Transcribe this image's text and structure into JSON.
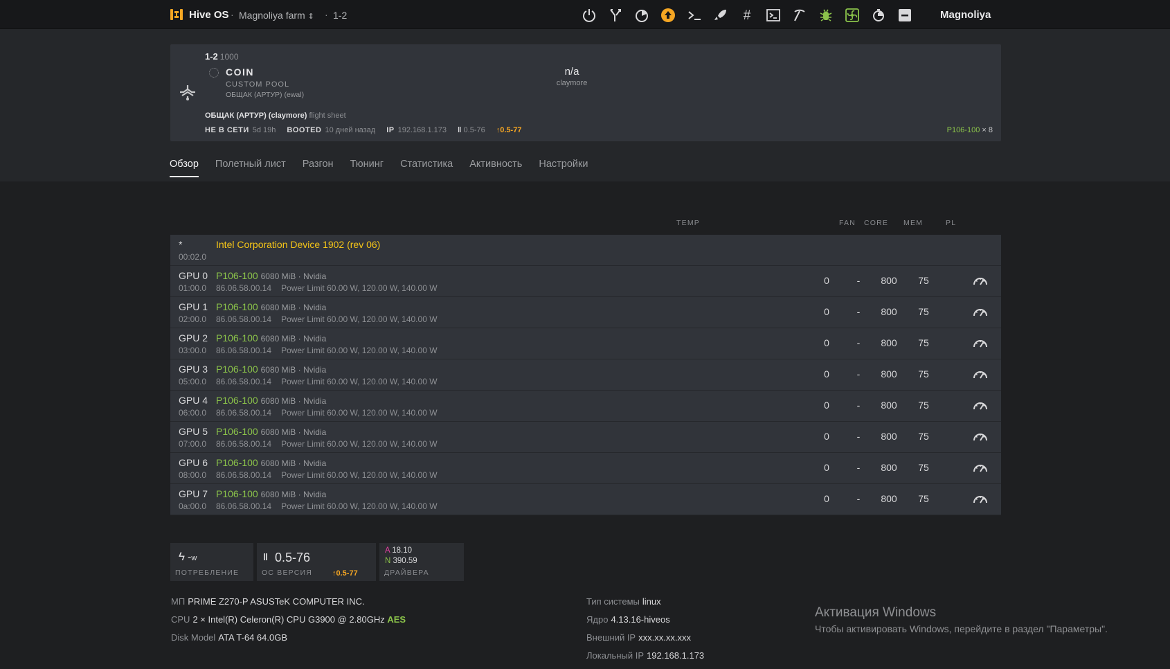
{
  "topbar": {
    "brand": "Hive OS",
    "farm": "Magnoliya farm",
    "rig": "1-2",
    "user": "Magnoliya",
    "icons": [
      "power-icon",
      "cross-arrows-icon",
      "chart-pie-icon",
      "upgrade-icon",
      "command-icon",
      "rocket-icon",
      "hash-icon",
      "terminal-icon",
      "pickaxe-icon",
      "bug-icon",
      "fan-icon",
      "stopwatch-icon",
      "minus-icon"
    ],
    "colors": {
      "orange": "#f5a623",
      "green": "#8bc34a",
      "yellow": "#f5c518"
    }
  },
  "rig": {
    "name": "1-2",
    "id": "1000",
    "coin": "COIN",
    "pool": "CUSTOM POOL",
    "wallet": "ОБЩАК (АРТУР) (ewal)",
    "hashrate": "n/a",
    "miner": "claymore",
    "flight_sheet": "ОБЩАК (АРТУР) (claymore)",
    "flight_sheet_suffix": "flight sheet",
    "offline_label": "НЕ В СЕТИ",
    "offline_value": "5d 19h",
    "booted_label": "BOOTED",
    "booted_value": "10 дней назад",
    "ip_label": "IP",
    "ip_value": "192.168.1.173",
    "version": "0.5-76",
    "version_update": "0.5-77",
    "gpu_model": "P106-100",
    "gpu_count": "× 8"
  },
  "tabs": [
    "Обзор",
    "Полетный лист",
    "Разгон",
    "Тюнинг",
    "Статистика",
    "Активность",
    "Настройки"
  ],
  "columns": {
    "temp": "TEMP",
    "fan": "FAN",
    "core": "CORE",
    "mem": "MEM",
    "pl": "PL"
  },
  "igpu": {
    "name": "*",
    "bus": "00:02.0",
    "title": "Intel Corporation Device 1902 (rev 06)"
  },
  "gpus": [
    {
      "name": "GPU 0",
      "bus": "01:00.0",
      "model": "P106-100",
      "mem": "6080 MiB · Nvidia",
      "bios": "86.06.58.00.14",
      "power": "Power Limit 60.00 W, 120.00 W, 140.00 W",
      "fan": "0",
      "core": "-",
      "memclk": "800",
      "pl": "75"
    },
    {
      "name": "GPU 1",
      "bus": "02:00.0",
      "model": "P106-100",
      "mem": "6080 MiB · Nvidia",
      "bios": "86.06.58.00.14",
      "power": "Power Limit 60.00 W, 120.00 W, 140.00 W",
      "fan": "0",
      "core": "-",
      "memclk": "800",
      "pl": "75"
    },
    {
      "name": "GPU 2",
      "bus": "03:00.0",
      "model": "P106-100",
      "mem": "6080 MiB · Nvidia",
      "bios": "86.06.58.00.14",
      "power": "Power Limit 60.00 W, 120.00 W, 140.00 W",
      "fan": "0",
      "core": "-",
      "memclk": "800",
      "pl": "75"
    },
    {
      "name": "GPU 3",
      "bus": "05:00.0",
      "model": "P106-100",
      "mem": "6080 MiB · Nvidia",
      "bios": "86.06.58.00.14",
      "power": "Power Limit 60.00 W, 120.00 W, 140.00 W",
      "fan": "0",
      "core": "-",
      "memclk": "800",
      "pl": "75"
    },
    {
      "name": "GPU 4",
      "bus": "06:00.0",
      "model": "P106-100",
      "mem": "6080 MiB · Nvidia",
      "bios": "86.06.58.00.14",
      "power": "Power Limit 60.00 W, 120.00 W, 140.00 W",
      "fan": "0",
      "core": "-",
      "memclk": "800",
      "pl": "75"
    },
    {
      "name": "GPU 5",
      "bus": "07:00.0",
      "model": "P106-100",
      "mem": "6080 MiB · Nvidia",
      "bios": "86.06.58.00.14",
      "power": "Power Limit 60.00 W, 120.00 W, 140.00 W",
      "fan": "0",
      "core": "-",
      "memclk": "800",
      "pl": "75"
    },
    {
      "name": "GPU 6",
      "bus": "08:00.0",
      "model": "P106-100",
      "mem": "6080 MiB · Nvidia",
      "bios": "86.06.58.00.14",
      "power": "Power Limit 60.00 W, 120.00 W, 140.00 W",
      "fan": "0",
      "core": "-",
      "memclk": "800",
      "pl": "75"
    },
    {
      "name": "GPU 7",
      "bus": "0a:00.0",
      "model": "P106-100",
      "mem": "6080 MiB · Nvidia",
      "bios": "86.06.58.00.14",
      "power": "Power Limit 60.00 W, 120.00 W, 140.00 W",
      "fan": "0",
      "core": "-",
      "memclk": "800",
      "pl": "75"
    }
  ],
  "boxes": {
    "power_value": "-",
    "power_unit": "w",
    "power_label": "ПОТРЕБЛЕНИЕ",
    "os_version": "0.5-76",
    "os_update": "0.5-77",
    "os_label": "ОС ВЕРСИЯ",
    "driver_a_label": "A",
    "driver_a": "18.10",
    "driver_n_label": "N",
    "driver_n": "390.59",
    "drivers_label": "ДРАЙВЕРА"
  },
  "sysinfo": {
    "mb_label": "МП",
    "mb": "PRIME Z270-P ASUSTeK COMPUTER INC.",
    "cpu_label": "CPU",
    "cpu": "2 × Intel(R) Celeron(R) CPU G3900 @ 2.80GHz",
    "cpu_aes": "AES",
    "disk_label": "Disk Model",
    "disk": "ATA T-64 64.0GB",
    "os_type_label": "Тип системы",
    "os_type": "linux",
    "kernel_label": "Ядро",
    "kernel": "4.13.16-hiveos",
    "ext_ip_label": "Внешний IP",
    "ext_ip": "xxx.xx.xx.xxx",
    "local_ip_label": "Локальный IP",
    "local_ip": "192.168.1.173"
  },
  "windows": {
    "title": "Активация Windows",
    "subtitle": "Чтобы активировать Windows, перейдите в раздел \"Параметры\"."
  }
}
